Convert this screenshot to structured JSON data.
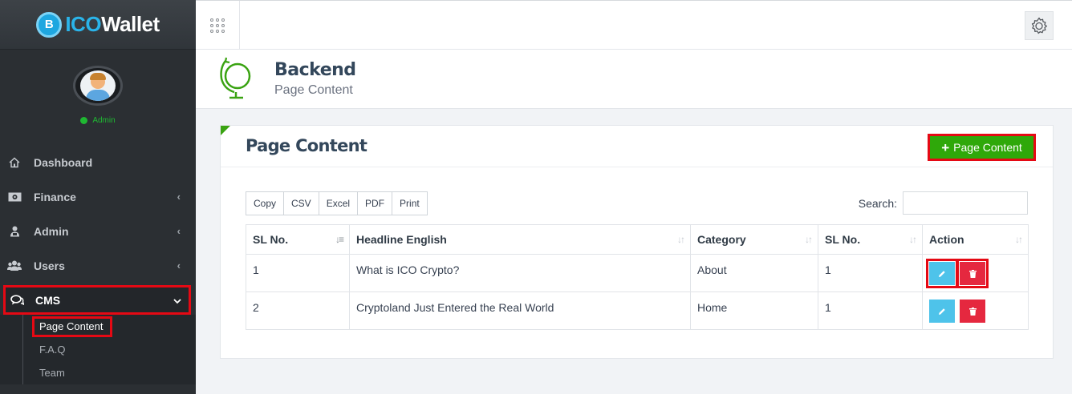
{
  "brand": {
    "logo_letter": "B",
    "name_part1": "ICO",
    "name_part2": "Wallet"
  },
  "profile": {
    "status": "Admin"
  },
  "sidebar": {
    "items": [
      {
        "label": "Dashboard",
        "icon": "home-icon"
      },
      {
        "label": "Finance",
        "icon": "money-icon",
        "chevron": "‹"
      },
      {
        "label": "Admin",
        "icon": "user-lock-icon",
        "chevron": "‹"
      },
      {
        "label": "Users",
        "icon": "users-icon",
        "chevron": "‹"
      },
      {
        "label": "CMS",
        "icon": "comments-icon",
        "chevron": "⌄"
      }
    ],
    "submenu": [
      {
        "label": "Page Content"
      },
      {
        "label": "F.A.Q"
      },
      {
        "label": "Team"
      }
    ]
  },
  "page_header": {
    "title": "Backend",
    "subtitle": "Page Content"
  },
  "card": {
    "title": "Page Content",
    "add_button": "Page Content",
    "tools": [
      "Copy",
      "CSV",
      "Excel",
      "PDF",
      "Print"
    ],
    "search_label": "Search:",
    "search_value": ""
  },
  "table": {
    "columns": [
      "SL No.",
      "Headline English",
      "Category",
      "SL No.",
      "Action"
    ],
    "rows": [
      {
        "sl": "1",
        "headline": "What is ICO Crypto?",
        "category": "About",
        "sl2": "1"
      },
      {
        "sl": "2",
        "headline": "Cryptoland Just Entered the Real World",
        "category": "Home",
        "sl2": "1"
      }
    ]
  },
  "colors": {
    "accent_green": "#2fa80a",
    "highlight_red": "#e50914",
    "edit_blue": "#4ec3ea",
    "delete_red": "#e5283f",
    "sidebar_bg": "#2b2f33"
  }
}
